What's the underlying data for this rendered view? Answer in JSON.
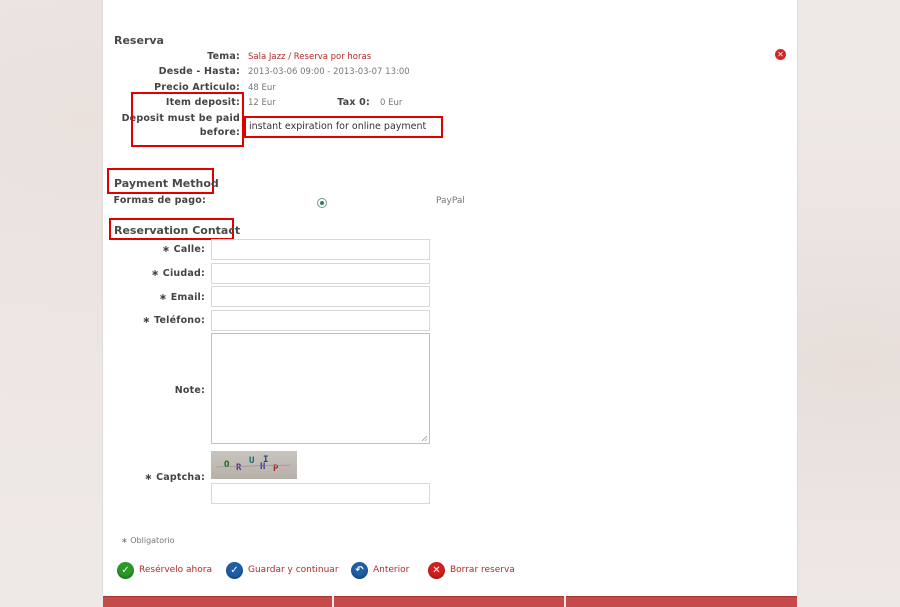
{
  "sections": {
    "reserva": "Reserva",
    "payment": "Payment Method",
    "contact": "Reservation Contact"
  },
  "reserva": {
    "tema_label": "Tema:",
    "tema_value": "Sala Jazz / Reserva por horas",
    "desde_label": "Desde - Hasta:",
    "desde_value": "2013-03-06 09:00 - 2013-03-07 13:00",
    "precio_label": "Precio Articulo:",
    "precio_value": "48 Eur",
    "deposit_label": "Item deposit:",
    "deposit_value": "12 Eur",
    "tax_label": "Tax 0:",
    "tax_value": "0 Eur",
    "before_label_1": "Deposit must be paid",
    "before_label_2": "before:",
    "before_value": "instant expiration for online payment"
  },
  "payment": {
    "formas_label": "Formas de pago:",
    "option": "PayPal"
  },
  "contact": {
    "calle": "Calle:",
    "ciudad": "Ciudad:",
    "email": "Email:",
    "telefono": "Teléfono:",
    "note": "Note:",
    "captcha": "Captcha:",
    "captcha_chars": [
      "O",
      "R",
      "U",
      "H",
      "I",
      "P"
    ]
  },
  "obligatorio": "Obligatorio",
  "actions": {
    "reservar": "Resérvelo ahora",
    "guardar": "Guardar y continuar",
    "anterior": "Anterior",
    "borrar": "Borrar reserva"
  },
  "colors": {
    "highlight_box": "#e00000",
    "link_red": "#b22a2a",
    "green": "#2a9a2a",
    "blue": "#1f5fa8",
    "red": "#d02020"
  }
}
